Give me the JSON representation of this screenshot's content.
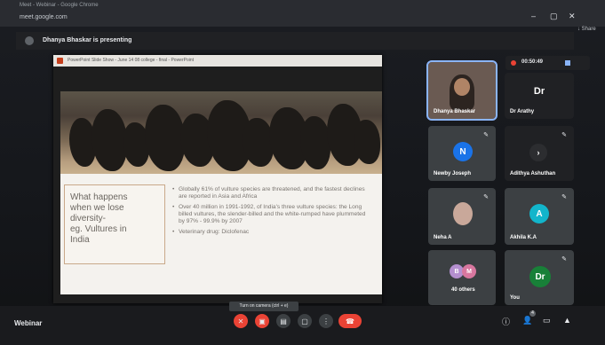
{
  "browser": {
    "window_title": "Meet - Webinar - Google Chrome",
    "url": "meet.google.com",
    "controls": [
      "–",
      "▢",
      "✕"
    ],
    "share_label": "↓ Share"
  },
  "presenting_banner": "Dhanya Bhaskar is presenting",
  "ppt": {
    "window_title": "PowerPoint Slide Show - June 14 08 college - final - PowerPoint",
    "slide_heading": "What happens\nwhen we lose\ndiversity-\neg. Vultures in\nIndia",
    "bullets": [
      "Globally 61% of vulture species are threatened, and the fastest declines are reported in Asia and Africa",
      "Over 40 million in 1991-1992, of India's three vulture species: the Long billed vultures, the slender-billed and the white-rumped have plummeted by 97% - 99.9% by 2007",
      "Veterinary drug: Diclofenac"
    ]
  },
  "timer": "00:50:49",
  "participants": [
    {
      "name": "Dhanya Bhaskar",
      "initial": "",
      "color": "#5a4a44",
      "muted": false
    },
    {
      "name": "Dr Arathy",
      "initial": "Dr",
      "color": "#202124",
      "muted": false
    },
    {
      "name": "Newby Joseph",
      "initial": "N",
      "color": "#1a73e8",
      "muted": true
    },
    {
      "name": "Adithya Ashuthan",
      "initial": "›",
      "color": "#202124",
      "muted": true
    },
    {
      "name": "Neha A",
      "initial": "",
      "color": "#3c4043",
      "muted": true
    },
    {
      "name": "Akhila K.A",
      "initial": "A",
      "color": "#12b5cb",
      "muted": true
    },
    {
      "name": "40 others",
      "initial": "",
      "color": "#b48fcf",
      "muted": false
    },
    {
      "name": "You",
      "initial": "Dr",
      "color": "#188038",
      "muted": true
    }
  ],
  "others_avatars": [
    "B",
    "M"
  ],
  "bottom_bar": {
    "meeting_name": "Webinar",
    "tooltip": "Turn on camera (ctrl + e)",
    "controls": [
      {
        "name": "mic",
        "glyph": "✕"
      },
      {
        "name": "camera",
        "glyph": "▣"
      },
      {
        "name": "captions",
        "glyph": "▤"
      },
      {
        "name": "present",
        "glyph": "▢"
      },
      {
        "name": "more",
        "glyph": "⋮"
      }
    ],
    "hangup_glyph": "☎",
    "right": [
      {
        "name": "info",
        "glyph": "ⓘ"
      },
      {
        "name": "people",
        "glyph": "👤",
        "badge": "4"
      },
      {
        "name": "chat",
        "glyph": "▭"
      },
      {
        "name": "activities",
        "glyph": "▲"
      }
    ]
  }
}
